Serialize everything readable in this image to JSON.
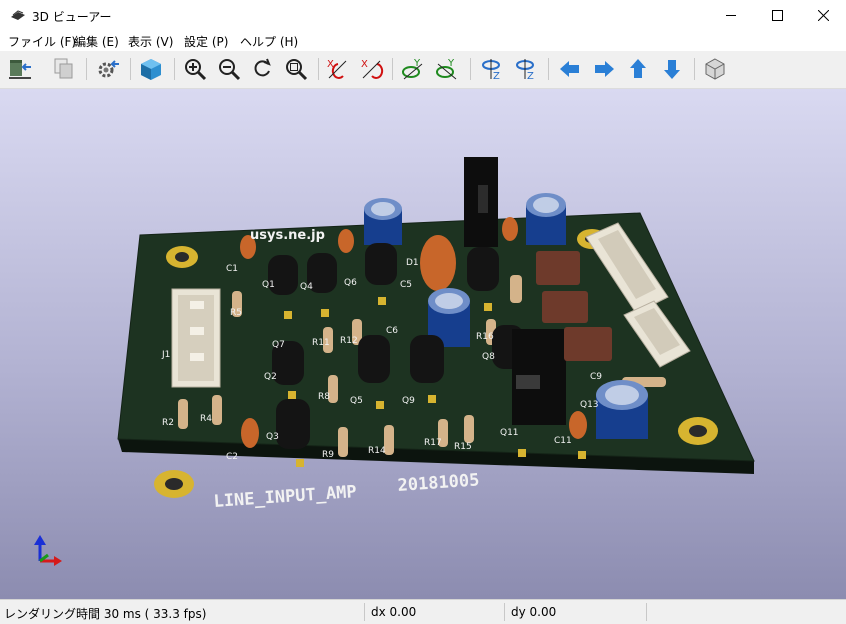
{
  "window": {
    "title": "3D ビューアー"
  },
  "menu": {
    "file": "ファイル (F)",
    "edit": "編集 (E)",
    "view": "表示 (V)",
    "preferences": "設定 (P)",
    "help": "ヘルプ (H)"
  },
  "toolbar": {
    "icons": [
      "reload-board-icon",
      "copy-image-icon",
      "settings-icon",
      "raytracing-cube-icon",
      "zoom-in-icon",
      "zoom-out-icon",
      "redraw-icon",
      "zoom-fit-icon",
      "rotate-x-cw-icon",
      "rotate-x-ccw-icon",
      "rotate-y-cw-icon",
      "rotate-y-ccw-icon",
      "rotate-z-cw-icon",
      "rotate-z-ccw-icon",
      "pan-left-icon",
      "pan-right-icon",
      "pan-up-icon",
      "pan-down-icon",
      "orthographic-cube-icon"
    ]
  },
  "board": {
    "silkscreen_title": "LINE_INPUT_AMP",
    "silkscreen_date": "20181005",
    "silkscreen_domain": "usys.ne.jp",
    "designators": [
      "C1",
      "R5",
      "J1",
      "R2",
      "R4",
      "C2",
      "Q1",
      "Q2",
      "Q3",
      "Q4",
      "Q5",
      "Q6",
      "Q7",
      "Q8",
      "Q9",
      "R8",
      "R9",
      "R11",
      "R12",
      "R14",
      "R15",
      "R16",
      "R17",
      "C5",
      "C6",
      "C9",
      "C11",
      "Q11",
      "Q13",
      "D1"
    ],
    "colors": {
      "soldermask": "#1d3321",
      "silkscreen": "#f2f2f2",
      "copper_pad": "#d7b430"
    }
  },
  "status": {
    "render_time": "レンダリング時間 30 ms ( 33.3 fps)",
    "dx": "dx 0.00",
    "dy": "dy 0.00"
  },
  "colors": {
    "viewport_top": "#d9d9f1",
    "viewport_bottom": "#8c8cb0",
    "toolbar_bg": "#f0f0f0"
  }
}
